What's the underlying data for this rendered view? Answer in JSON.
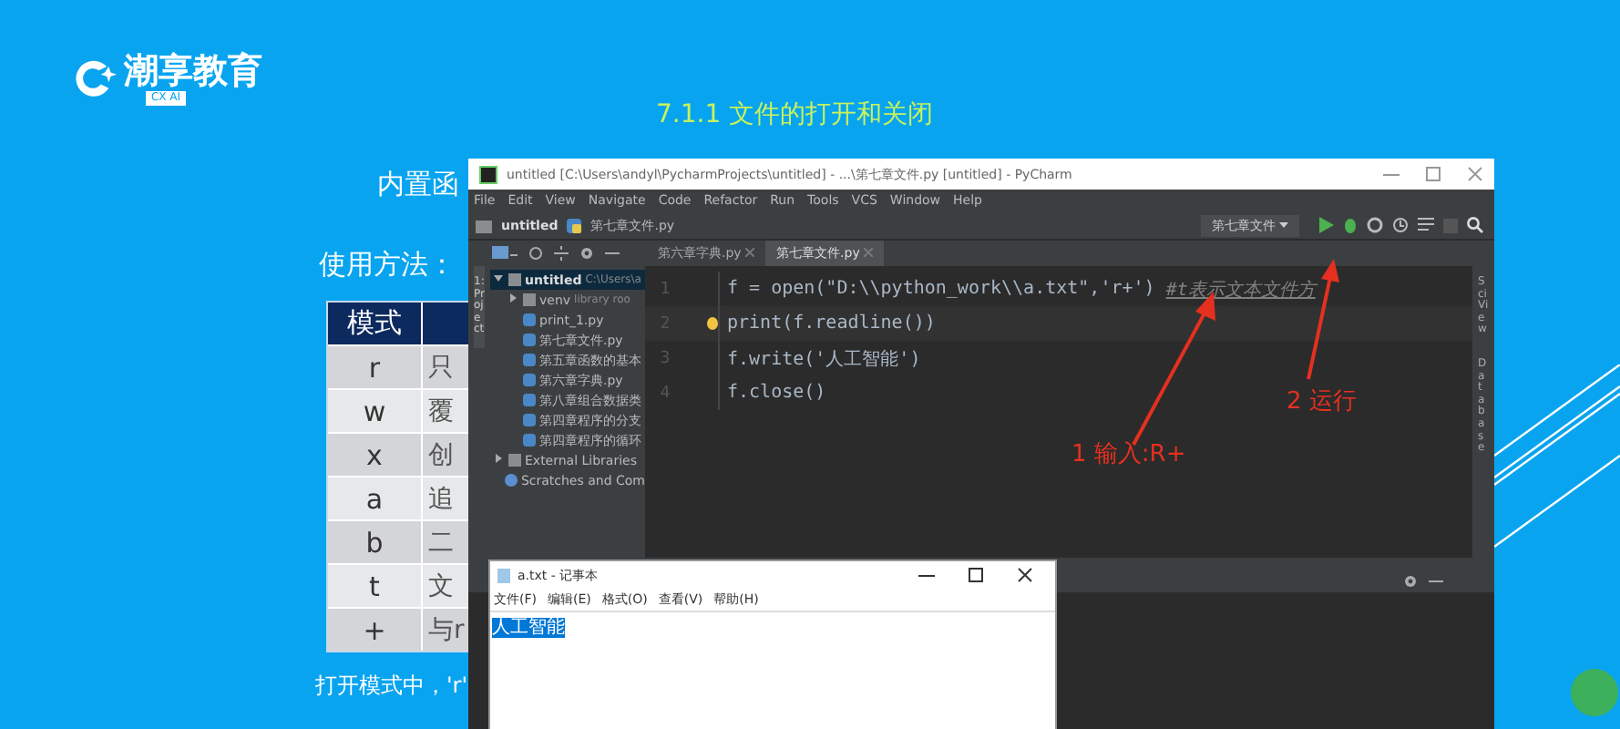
{
  "slide": {
    "logo": {
      "name": "潮享教育",
      "badge": "CX AI"
    },
    "title": "7.1.1 文件的打开和关闭",
    "intro": "内置函",
    "usage_label": "使用方法：",
    "footer": "打开模式中，'r'"
  },
  "mode_table": {
    "header": "模式",
    "rows": [
      {
        "mode": "r",
        "desc": "只"
      },
      {
        "mode": "w",
        "desc": "覆"
      },
      {
        "mode": "x",
        "desc": "创"
      },
      {
        "mode": "a",
        "desc": "追"
      },
      {
        "mode": "b",
        "desc": "二"
      },
      {
        "mode": "t",
        "desc": "文"
      },
      {
        "mode": "+",
        "desc": "与r"
      }
    ]
  },
  "pycharm": {
    "title": "untitled [C:\\Users\\andyl\\PycharmProjects\\untitled] - ...\\第七章文件.py [untitled] - PyCharm",
    "menu": [
      "File",
      "Edit",
      "View",
      "Navigate",
      "Code",
      "Refactor",
      "Run",
      "Tools",
      "VCS",
      "Window",
      "Help"
    ],
    "breadcrumbs": [
      "untitled",
      "第七章文件.py"
    ],
    "run_config": "第七章文件",
    "tabs": [
      {
        "label": "第六章字典.py",
        "selected": false
      },
      {
        "label": "第七章文件.py",
        "selected": true
      }
    ],
    "left_tool": "1: Project",
    "right_tools": [
      "SciView",
      "Database"
    ],
    "tree": [
      {
        "label": "untitled",
        "hint": "C:\\Users\\a",
        "kind": "folder",
        "expanded": true,
        "selected": true,
        "children": [
          {
            "label": "venv",
            "hint": "library roo",
            "kind": "folder",
            "expanded": false,
            "selected": false
          },
          {
            "label": "print_1.py",
            "kind": "file",
            "selected": false
          },
          {
            "label": "第七章文件.py",
            "kind": "file",
            "selected": false
          },
          {
            "label": "第五章函数的基本",
            "kind": "file",
            "selected": false
          },
          {
            "label": "第六章字典.py",
            "kind": "file",
            "selected": false
          },
          {
            "label": "第八章组合数据类",
            "kind": "file",
            "selected": false
          },
          {
            "label": "第四章程序的分支",
            "kind": "file",
            "selected": false
          },
          {
            "label": "第四章程序的循环",
            "kind": "file",
            "selected": false
          }
        ]
      },
      {
        "label": "External Libraries",
        "kind": "library",
        "expanded": false,
        "selected": false
      },
      {
        "label": "Scratches and Com",
        "kind": "scratch",
        "selected": false
      }
    ],
    "code": [
      {
        "number": "1",
        "text": "f = open(\"D:\\\\python_work\\\\a.txt\",'r+')",
        "comment": "#t表示文本文件方"
      },
      {
        "number": "2",
        "text": "print(f.readline())",
        "bulb": true
      },
      {
        "number": "3",
        "text": "f.write('人工智能')"
      },
      {
        "number": "4",
        "text": "f.close()"
      }
    ]
  },
  "notepad": {
    "title": "a.txt - 记事本",
    "menu": [
      "文件(F)",
      "编辑(E)",
      "格式(O)",
      "查看(V)",
      "帮助(H)"
    ],
    "content": "人工智能",
    "selected": true
  },
  "annotations": [
    {
      "label": "1 输入:R+"
    },
    {
      "label": "2 运行"
    }
  ]
}
